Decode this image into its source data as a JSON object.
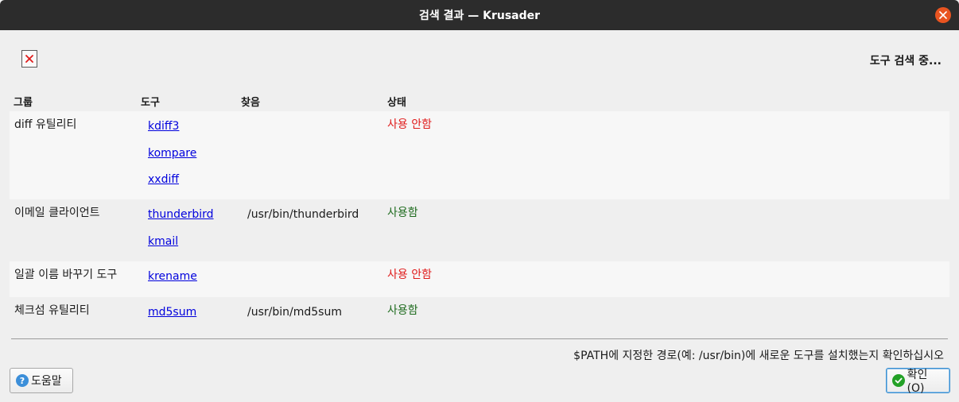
{
  "window": {
    "title": "검색 결과 — Krusader"
  },
  "status": {
    "text": "도구 검색 중..."
  },
  "columns": {
    "group": "그룹",
    "tool": "도구",
    "found": "찾음",
    "state": "상태"
  },
  "rows": [
    {
      "group": "diff 유틸리티",
      "tools": [
        {
          "name": "kdiff3",
          "found": ""
        },
        {
          "name": "kompare",
          "found": ""
        },
        {
          "name": "xxdiff",
          "found": ""
        }
      ],
      "state": "사용 안함",
      "enabled": false
    },
    {
      "group": "이메일 클라이언트",
      "tools": [
        {
          "name": "thunderbird",
          "found": "/usr/bin/thunderbird"
        },
        {
          "name": "kmail",
          "found": ""
        }
      ],
      "state": "사용함",
      "enabled": true
    },
    {
      "group": "일괄 이름 바꾸기 도구",
      "tools": [
        {
          "name": "krename",
          "found": ""
        }
      ],
      "state": "사용 안함",
      "enabled": false
    },
    {
      "group": "체크섬 유틸리티",
      "tools": [
        {
          "name": "md5sum",
          "found": "/usr/bin/md5sum"
        }
      ],
      "state": "사용함",
      "enabled": true
    }
  ],
  "footer": {
    "hint": "$PATH에 지정한 경로(예: /usr/bin)에 새로운 도구를 설치했는지 확인하십시오",
    "help_label": "도움말",
    "ok_label": "확인(O)"
  },
  "colors": {
    "disabled": "#e01b1b",
    "enabled": "#1e6b1e",
    "link": "#0000dd",
    "titlebar": "#2c2c2c",
    "close": "#e95420"
  },
  "icons": {
    "close": "close-icon",
    "status": "error-cross-icon",
    "help": "help-icon",
    "ok": "check-circle-icon"
  }
}
